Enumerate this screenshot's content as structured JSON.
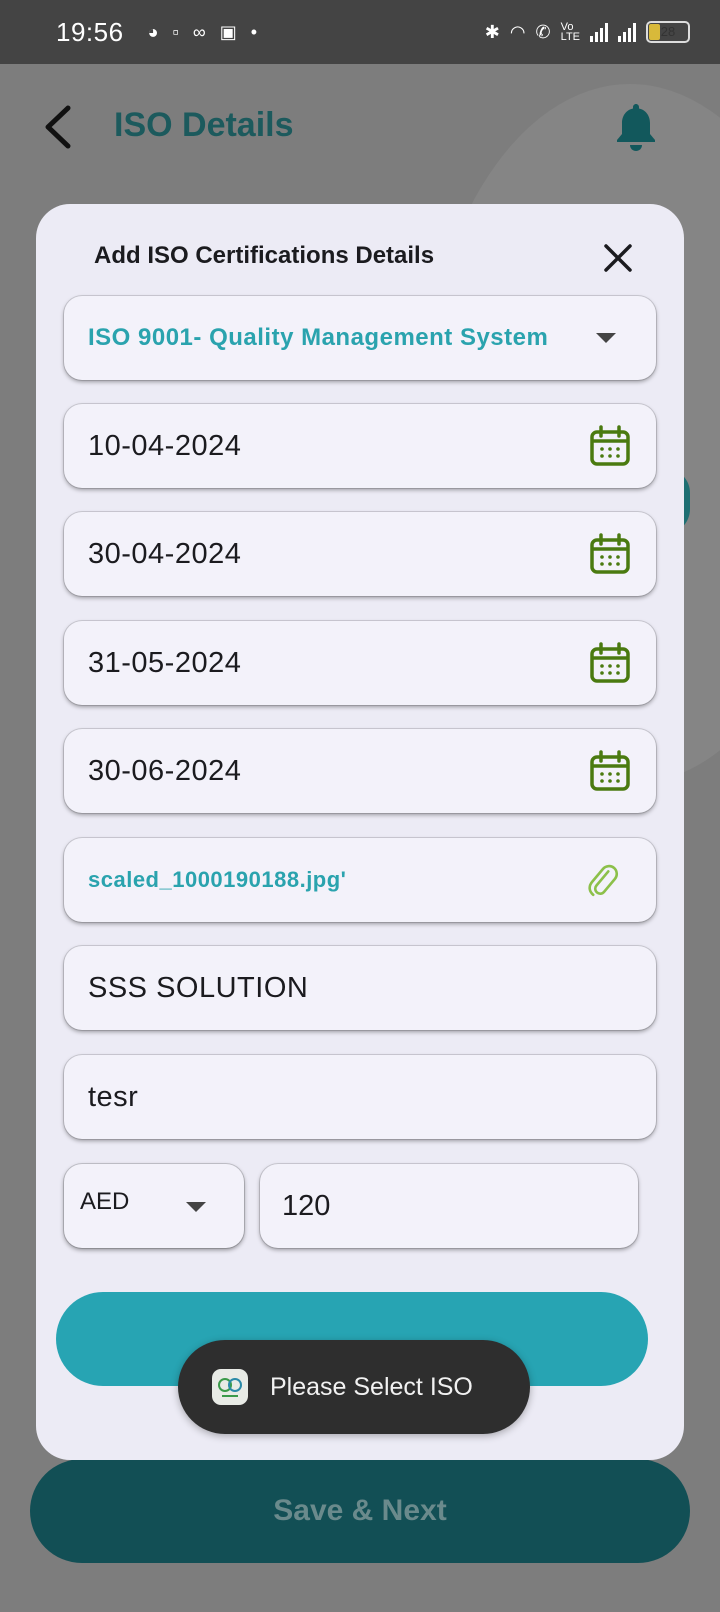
{
  "status_bar": {
    "time": "19:56",
    "battery_level": "28"
  },
  "header": {
    "title": "ISO Details"
  },
  "modal": {
    "title": "Add ISO Certifications Details",
    "iso_select": {
      "value": "ISO 9001- Quality Management System"
    },
    "date_fields": [
      {
        "value": "10-04-2024"
      },
      {
        "value": "30-04-2024"
      },
      {
        "value": "31-05-2024"
      },
      {
        "value": "30-06-2024"
      }
    ],
    "attachment": {
      "value": "scaled_1000190188.jpg'"
    },
    "company_field": {
      "value": "SSS SOLUTION"
    },
    "remarks_field": {
      "value": "tesr"
    },
    "currency": {
      "value": "AED"
    },
    "amount": {
      "value": "120"
    }
  },
  "toast": {
    "message": "Please Select ISO"
  },
  "footer": {
    "save_next_label": "Save & Next"
  },
  "colors": {
    "accent_teal": "#2aa3ae",
    "primary_dark": "#124f55",
    "icon_green": "#4a7a10"
  },
  "icons": {
    "back": "back-arrow-icon",
    "bell": "bell-icon",
    "close": "close-icon",
    "calendar": "calendar-icon",
    "attachment": "paperclip-icon",
    "dropdown": "chevron-down-icon"
  }
}
